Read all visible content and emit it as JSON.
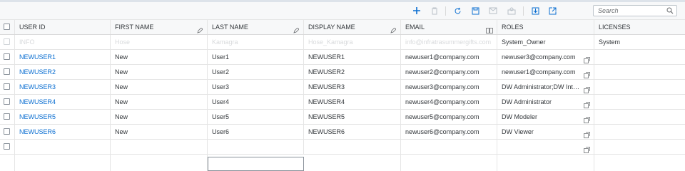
{
  "toolbar": {
    "add_icon": "plus-icon",
    "delete_icon": "trash-icon",
    "refresh_icon": "refresh-icon",
    "save_icon": "save-icon",
    "mail_icon": "mail-icon",
    "roles_icon": "assign-icon",
    "import_icon": "import-icon",
    "export_icon": "export-icon",
    "search_placeholder": "Search"
  },
  "columns": [
    "USER ID",
    "FIRST NAME",
    "LAST NAME",
    "DISPLAY NAME",
    "EMAIL",
    "ROLES",
    "LICENSES"
  ],
  "template_row": {
    "user_id": "INFO",
    "first_name": "Hose",
    "last_name": "Kamagra",
    "display_name": "Hose_Kamagra",
    "email": "info@infratrasummergifts.com",
    "roles": "System_Owner",
    "licenses": "System"
  },
  "rows": [
    {
      "user_id": "NEWUSER1",
      "first_name": "New",
      "last_name": "User1",
      "display_name": "NEWUSER1",
      "email": "newuser1@company.com",
      "roles": "newuser3@company.com"
    },
    {
      "user_id": "NEWUSER2",
      "first_name": "New",
      "last_name": "User2",
      "display_name": "NEWUSER2",
      "email": "newuser2@company.com",
      "roles": "newuser1@company.com"
    },
    {
      "user_id": "NEWUSER3",
      "first_name": "New",
      "last_name": "User3",
      "display_name": "NEWUSER3",
      "email": "newuser3@company.com",
      "roles": "DW Administrator;DW Inte…"
    },
    {
      "user_id": "NEWUSER4",
      "first_name": "New",
      "last_name": "User4",
      "display_name": "NEWUSER4",
      "email": "newuser4@company.com",
      "roles": "DW Administrator"
    },
    {
      "user_id": "NEWUSER5",
      "first_name": "New",
      "last_name": "User5",
      "display_name": "NEWUSER5",
      "email": "newuser5@company.com",
      "roles": "DW Modeler"
    },
    {
      "user_id": "NEWUSER6",
      "first_name": "New",
      "last_name": "User6",
      "display_name": "NEWUSER6",
      "email": "newuser6@company.com",
      "roles": "DW Viewer"
    }
  ],
  "colors": {
    "link": "#0a6ed1",
    "accent_add": "#0a6ed1"
  }
}
